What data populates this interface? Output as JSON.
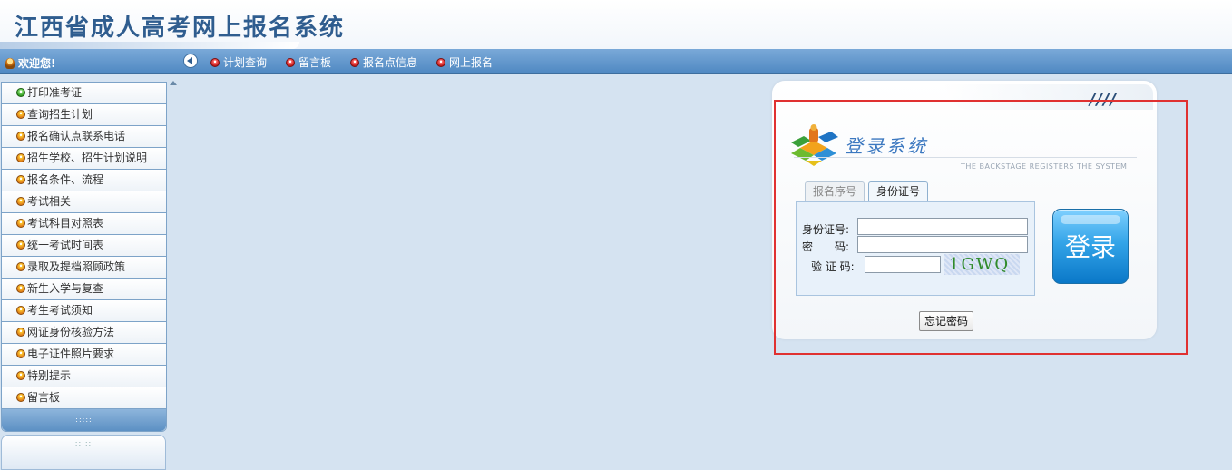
{
  "header": {
    "title": "江西省成人高考网上报名系统"
  },
  "nav": {
    "welcome": "欢迎您!",
    "links": [
      "计划查询",
      "留言板",
      "报名点信息",
      "网上报名"
    ]
  },
  "sidebar": {
    "items": [
      {
        "label": "打印准考证",
        "bullet": "green"
      },
      {
        "label": "查询招生计划",
        "bullet": "orange"
      },
      {
        "label": "报名确认点联系电话",
        "bullet": "orange"
      },
      {
        "label": "招生学校、招生计划说明",
        "bullet": "orange"
      },
      {
        "label": "报名条件、流程",
        "bullet": "orange"
      },
      {
        "label": "考试相关",
        "bullet": "orange"
      },
      {
        "label": "考试科目对照表",
        "bullet": "orange"
      },
      {
        "label": "统一考试时间表",
        "bullet": "orange"
      },
      {
        "label": "录取及提档照顾政策",
        "bullet": "orange"
      },
      {
        "label": "新生入学与复查",
        "bullet": "orange"
      },
      {
        "label": "考生考试须知",
        "bullet": "orange"
      },
      {
        "label": "网证身份核验方法",
        "bullet": "orange"
      },
      {
        "label": "电子证件照片要求",
        "bullet": "orange"
      },
      {
        "label": "特别提示",
        "bullet": "orange"
      },
      {
        "label": "留言板",
        "bullet": "orange"
      }
    ],
    "footer_dots": ":::::",
    "panel2_dots": ":::::"
  },
  "login": {
    "title": "登录系统",
    "subtitle": "THE BACKSTAGE REGISTERS THE SYSTEM",
    "tabs": [
      "报名序号",
      "身份证号"
    ],
    "active_tab": "身份证号",
    "fields": {
      "id_label": "身份证号:",
      "id_value": "",
      "password_label": "密　　码:",
      "password_value": "",
      "captcha_label": "验 证 码:",
      "captcha_value": "",
      "captcha_image_text": "1GWQ"
    },
    "login_button": "登录",
    "forgot_button": "忘记密码",
    "decor_stripes": "////"
  },
  "colors": {
    "nav_bar": "#5a93cc",
    "highlight": "#e03131",
    "login_button": "#1c8fd8",
    "title_text": "#2f5d8f"
  }
}
